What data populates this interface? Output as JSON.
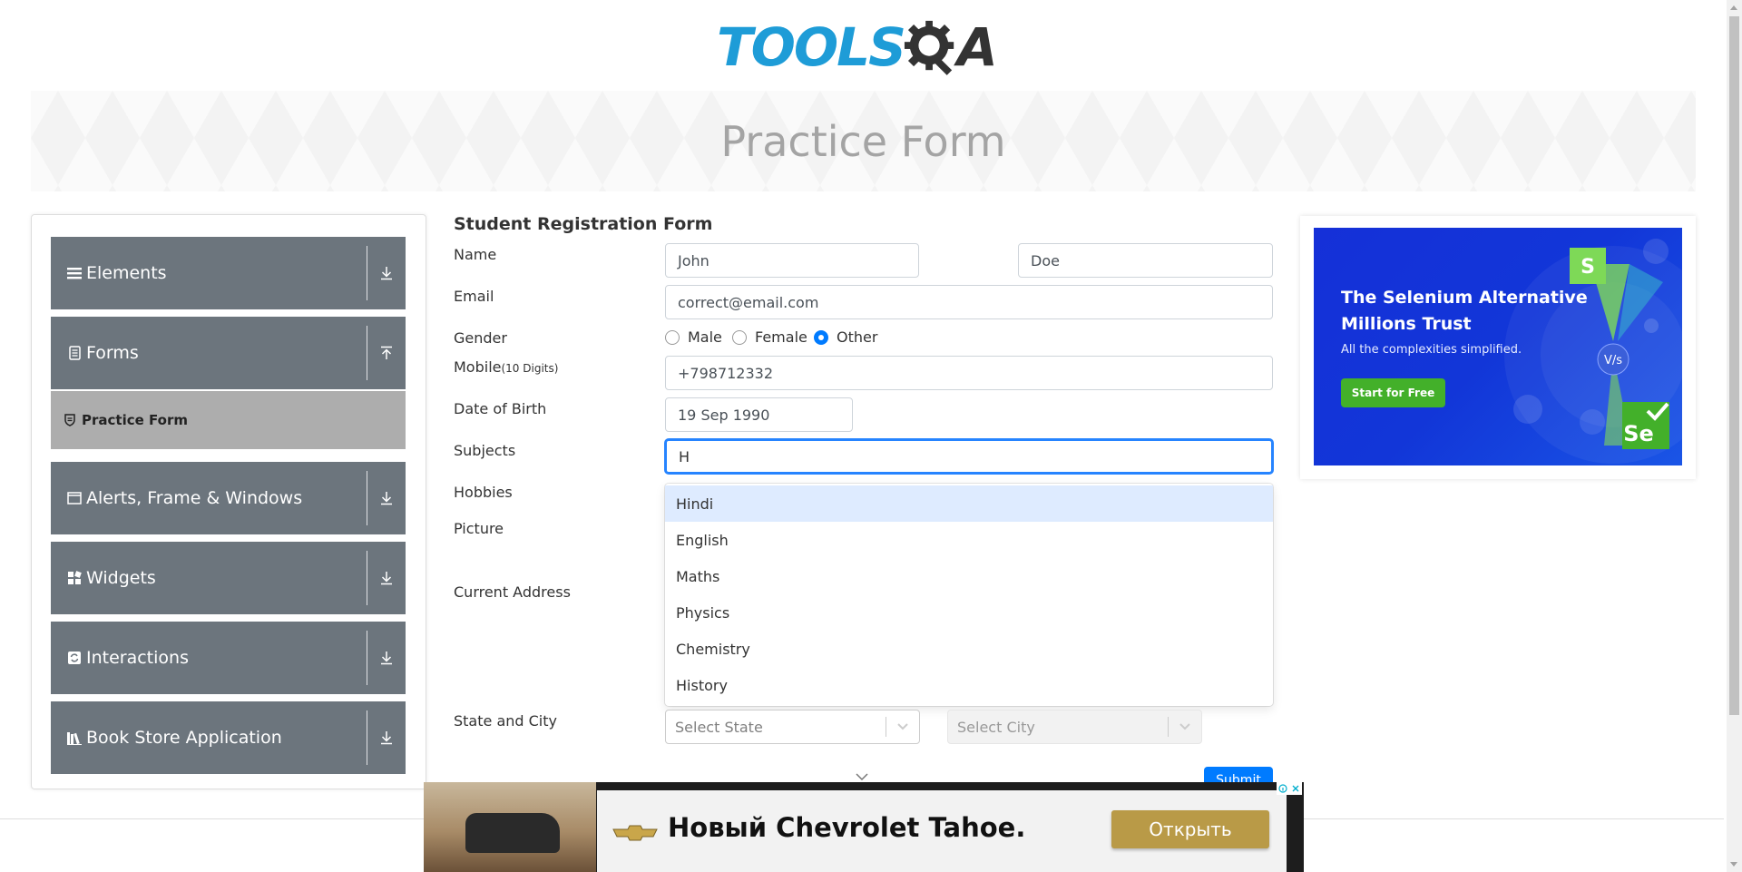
{
  "logo": {
    "part1": "TOOLS",
    "part2": "A"
  },
  "page_title": "Practice Form",
  "sidebar": {
    "groups": [
      {
        "label": "Elements",
        "icon": "list-icon",
        "arrow": "down"
      },
      {
        "label": "Forms",
        "icon": "document-icon",
        "arrow": "up"
      },
      {
        "label": "Alerts, Frame & Windows",
        "icon": "window-icon",
        "arrow": "down"
      },
      {
        "label": "Widgets",
        "icon": "widgets-icon",
        "arrow": "down"
      },
      {
        "label": "Interactions",
        "icon": "interactions-icon",
        "arrow": "down"
      },
      {
        "label": "Book Store Application",
        "icon": "books-icon",
        "arrow": "down"
      }
    ],
    "active_item": "Practice Form"
  },
  "form": {
    "title": "Student Registration Form",
    "labels": {
      "name": "Name",
      "email": "Email",
      "gender": "Gender",
      "mobile": "Mobile",
      "mobile_hint": "(10 Digits)",
      "dob": "Date of Birth",
      "subjects": "Subjects",
      "hobbies": "Hobbies",
      "picture": "Picture",
      "address": "Current Address",
      "state_city": "State and City"
    },
    "first_name": "John",
    "last_name": "Doe",
    "email": "correct@email.com",
    "gender_options": [
      "Male",
      "Female",
      "Other"
    ],
    "gender_selected": "Other",
    "mobile": "+798712332",
    "dob": "19 Sep 1990",
    "subjects_input": "H",
    "subject_options": [
      "Hindi",
      "English",
      "Maths",
      "Physics",
      "Chemistry",
      "History"
    ],
    "focused_option": "Hindi",
    "state_placeholder": "Select State",
    "city_placeholder": "Select City",
    "submit_label": "Submit"
  },
  "side_ad": {
    "title_line1": "The Selenium Alternative",
    "title_line2": "Millions Trust",
    "subtitle": "All the complexities simplified.",
    "button": "Start for Free"
  },
  "bottom_ad": {
    "text": "Новый Chevrolet Tahoe.",
    "button": "Открыть"
  }
}
